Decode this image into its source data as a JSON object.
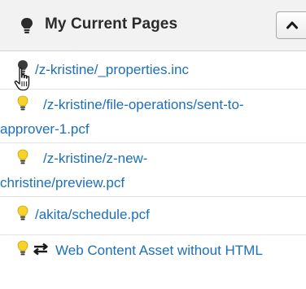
{
  "panel": {
    "title": "My Current Pages",
    "header_icon": "bulb-off-icon",
    "collapse_icon": "chevron-up-icon"
  },
  "pages": [
    {
      "path": "/z-kristine/_properties.inc",
      "icon": "bulb-off-icon"
    },
    {
      "path": "/z-kristine/file-operations/sent-to-approver-1.pcf",
      "icon": "bulb-on-icon"
    },
    {
      "path": "/z-kristine/z-new-christine/preview.pcf",
      "icon": "bulb-on-icon"
    },
    {
      "path": "/akita/schedule.pcf",
      "icon": "bulb-on-icon"
    },
    {
      "path": "Web Content Asset without HTML",
      "icon": "bulb-on-icon",
      "secondary_icon": "swap-arrows-icon"
    }
  ],
  "cursor": "hand-pointer-icon",
  "colors": {
    "link": "#1c6fb8",
    "bulb_on": "#f5d328",
    "bulb_off": "#3a3a3a",
    "header_bg": "#f2f2f2"
  }
}
